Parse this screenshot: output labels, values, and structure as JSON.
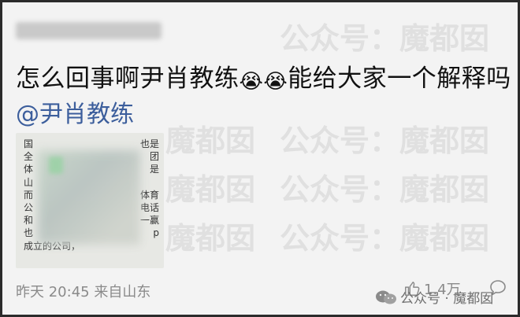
{
  "post": {
    "text": "怎么回事啊尹肖教练",
    "emoji_1": "😭",
    "emoji_2": "😭",
    "text_after": "能给大家一个解释吗",
    "mention": "@尹肖教练"
  },
  "attachment": {
    "lines": [
      {
        "left": "国",
        "right": "也是"
      },
      {
        "left": "全",
        "right": "团"
      },
      {
        "left": "体",
        "right": "是"
      },
      {
        "left": "山",
        "right": ""
      },
      {
        "left": "而",
        "right": "体育"
      },
      {
        "left": "公",
        "right": "电话"
      },
      {
        "left": "和",
        "right": "一赢"
      },
      {
        "left": "也",
        "right": "p"
      },
      {
        "left": "成立的公司，",
        "right": ""
      }
    ]
  },
  "meta": {
    "time": "昨天 20:45",
    "location": "来自山东"
  },
  "actions": {
    "like_count": "1.4万"
  },
  "watermark": {
    "text": "公众号：魔都囡",
    "short": "魔都囡",
    "badge": "公众号 · 魔都囡"
  },
  "colors": {
    "mention": "#3c5e9c",
    "meta": "#8a8a8a"
  }
}
